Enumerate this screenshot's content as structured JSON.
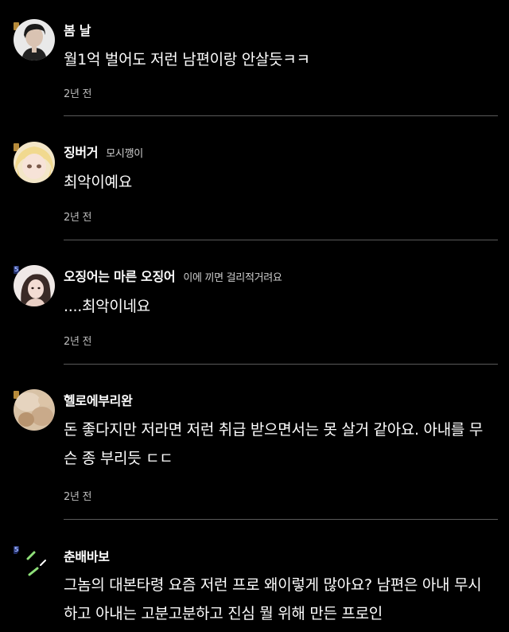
{
  "comments": [
    {
      "nickname": "봄 날",
      "status": "",
      "avatar": "avatar-person-dark-hair",
      "badge": "gold",
      "badge_text": "",
      "text": "월1억 벌어도 저런 남편이랑 안살듯ㅋㅋ",
      "time": "2년 전"
    },
    {
      "nickname": "징버거",
      "status": "모시깽이",
      "avatar": "avatar-blonde-girl",
      "badge": "gold",
      "badge_text": "",
      "text": " 최악이예요",
      "time": "2년 전"
    },
    {
      "nickname": "오징어는 마른 오징어",
      "status": "이에 끼면 걸리적거려요",
      "avatar": "avatar-woman-long-hair",
      "badge": "blue",
      "badge_text": "5",
      "text": "....최악이네요",
      "time": "2년 전"
    },
    {
      "nickname": "헬로에부리완",
      "status": "",
      "avatar": "avatar-blurry-hand",
      "badge": "gold",
      "badge_text": "",
      "text": "돈 좋다지만 저라면 저런 취급 받으면서는 못 살거 같아요. 아내를 무슨 종 부리듯 ㄷㄷ",
      "time": "2년 전"
    },
    {
      "nickname": "춘배바보",
      "status": "",
      "avatar": "avatar-green-dashes",
      "badge": "blue",
      "badge_text": "5",
      "text": "그놈의 대본타령 요즘 저런 프로 왜이렇게 많아요? 남편은 아내 무시하고 아내는 고분고분하고 진심 뭘 위해 만든 프로인",
      "time": ""
    }
  ],
  "colors": {
    "background": "#000000",
    "text": "#ffffff",
    "muted": "#bdbdbd",
    "divider": "#5a5a5a"
  }
}
